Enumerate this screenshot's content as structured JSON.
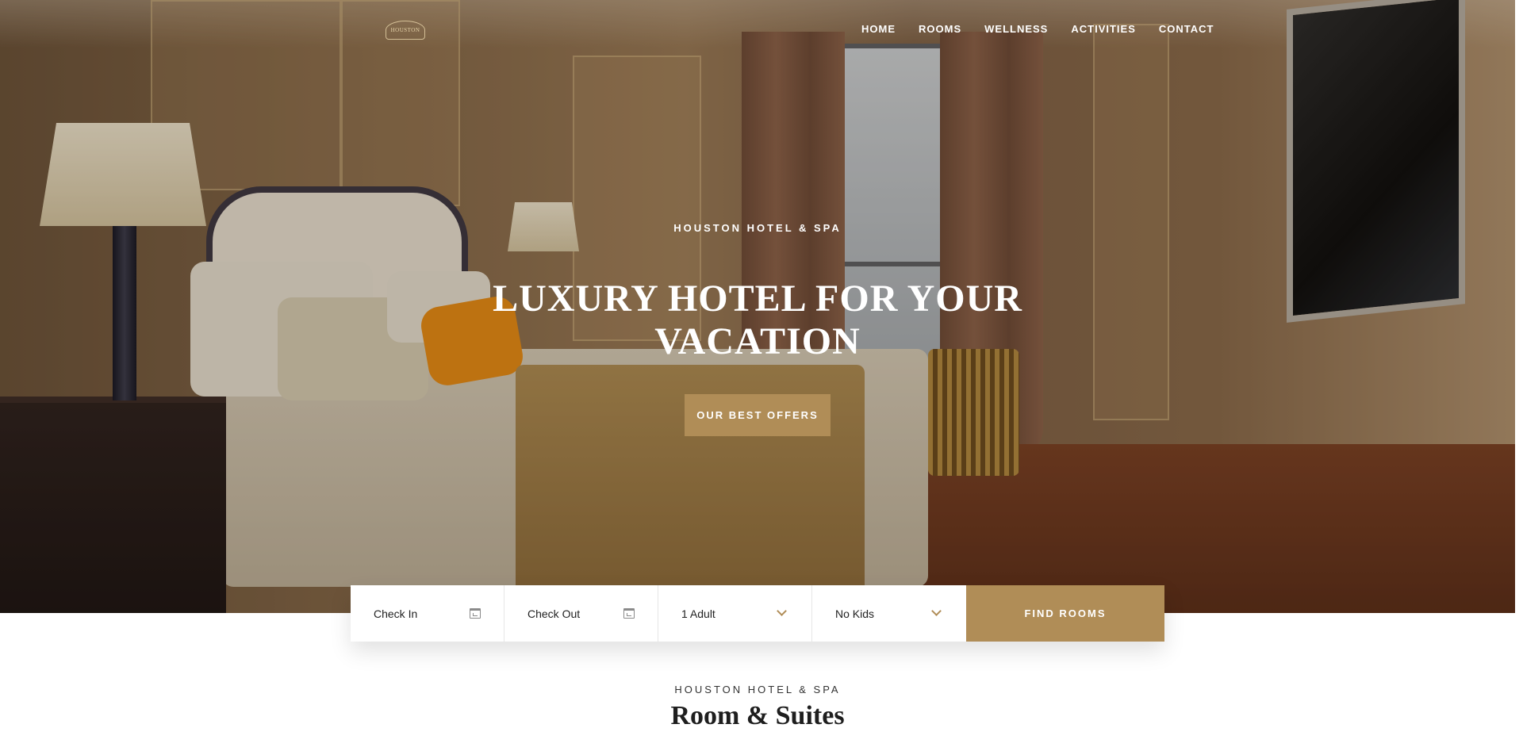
{
  "header": {
    "logo_text": "HOUSTON",
    "nav": [
      {
        "label": "HOME"
      },
      {
        "label": "ROOMS"
      },
      {
        "label": "WELLNESS"
      },
      {
        "label": "ACTIVITIES"
      },
      {
        "label": "CONTACT"
      }
    ]
  },
  "hero": {
    "eyebrow": "HOUSTON HOTEL & SPA",
    "title_line1": "LUXURY HOTEL FOR YOUR",
    "title_line2": "VACATION",
    "cta_label": "OUR BEST OFFERS"
  },
  "booking": {
    "check_in": "Check In",
    "check_out": "Check Out",
    "adults": "1 Adult",
    "kids": "No Kids",
    "submit_label": "FIND ROOMS"
  },
  "section": {
    "eyebrow": "HOUSTON HOTEL & SPA",
    "title": "Room & Suites"
  },
  "colors": {
    "accent": "#b08d57",
    "text_dark": "#1e1e1e",
    "white": "#ffffff"
  },
  "icons": {
    "calendar": "calendar-icon",
    "chevron": "chevron-down-icon"
  }
}
